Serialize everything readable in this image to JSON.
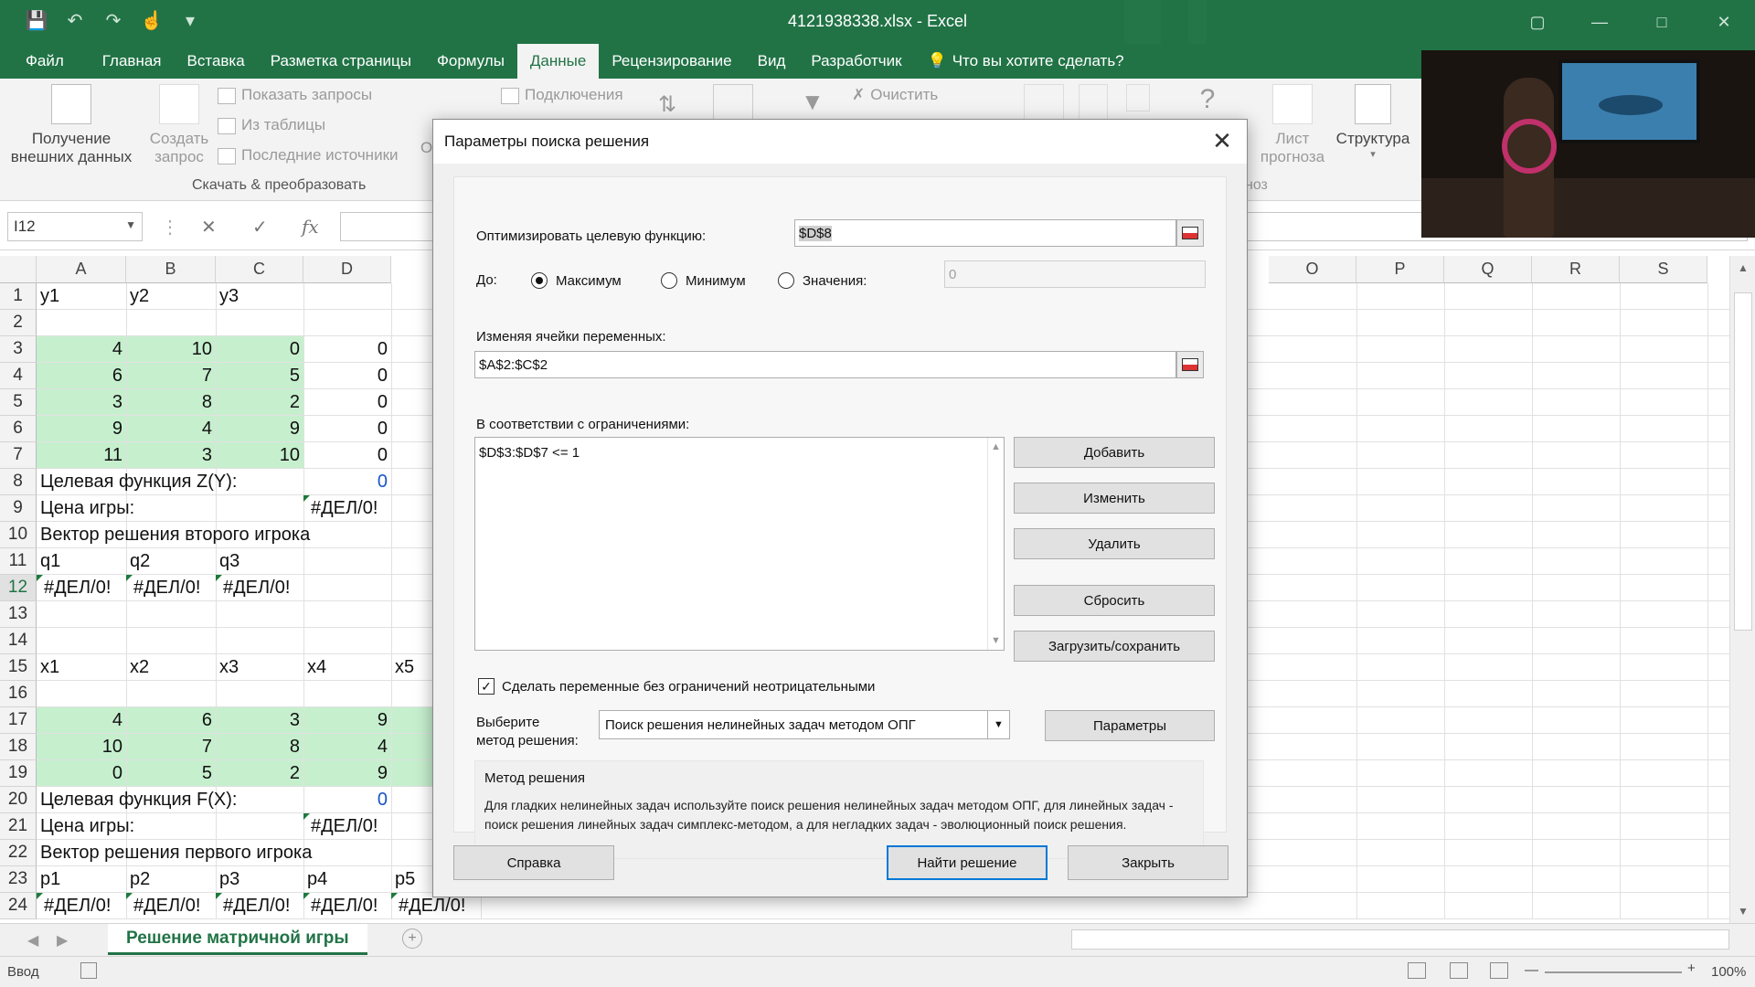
{
  "window": {
    "title": "4121938338.xlsx - Excel"
  },
  "tabs": [
    {
      "label": "Файл"
    },
    {
      "label": "Главная"
    },
    {
      "label": "Вставка"
    },
    {
      "label": "Разметка страницы"
    },
    {
      "label": "Формулы"
    },
    {
      "label": "Данные"
    },
    {
      "label": "Рецензирование"
    },
    {
      "label": "Вид"
    },
    {
      "label": "Разработчик"
    },
    {
      "label": "Что вы хотите сделать?"
    }
  ],
  "ribbon": {
    "get_external_line1": "Получение",
    "get_external_line2": "внешних данных",
    "create_query_line1": "Создать",
    "create_query_line2": "запрос",
    "show_queries": "Показать запросы",
    "from_table": "Из таблицы",
    "recent_sources": "Последние источники",
    "group_get_transform": "Скачать & преобразовать",
    "connections": "Подключения",
    "clear": "Очистить",
    "forecast_line1": "Лист",
    "forecast_line2": "прогноза",
    "forecast_group_tail": "ноз",
    "structure": "Структура",
    "partial_o": "О"
  },
  "formula_bar": {
    "name_box": "I12",
    "fx": "fx",
    "value": ""
  },
  "columns": [
    "A",
    "B",
    "C",
    "D",
    "O",
    "P",
    "Q",
    "R",
    "S"
  ],
  "rows": [
    "1",
    "2",
    "3",
    "4",
    "5",
    "6",
    "7",
    "8",
    "9",
    "10",
    "11",
    "12",
    "13",
    "14",
    "15",
    "16",
    "17",
    "18",
    "19",
    "20",
    "21",
    "22",
    "23",
    "24"
  ],
  "cells": {
    "A1": "y1",
    "B1": "y2",
    "C1": "y3",
    "A3": "4",
    "B3": "10",
    "C3": "0",
    "D3": "0",
    "A4": "6",
    "B4": "7",
    "C4": "5",
    "D4": "0",
    "A5": "3",
    "B5": "8",
    "C5": "2",
    "D5": "0",
    "A6": "9",
    "B6": "4",
    "C6": "9",
    "D6": "0",
    "A7": "11",
    "B7": "3",
    "C7": "10",
    "D7": "0",
    "A8": "Целевая функция Z(Y):",
    "D8": "0",
    "A9": "Цена игры:",
    "D9": "#ДЕЛ/0!",
    "A10": "Вектор решения второго игрока",
    "A11": "q1",
    "B11": "q2",
    "C11": "q3",
    "A12": "#ДЕЛ/0!",
    "B12": "#ДЕЛ/0!",
    "C12": "#ДЕЛ/0!",
    "A15": "x1",
    "B15": "x2",
    "C15": "x3",
    "D15": "x4",
    "E15": "x5",
    "A17": "4",
    "B17": "6",
    "C17": "3",
    "D17": "9",
    "A18": "10",
    "B18": "7",
    "C18": "8",
    "D18": "4",
    "A19": "0",
    "B19": "5",
    "C19": "2",
    "D19": "9",
    "A20": "Целевая функция F(X):",
    "D20": "0",
    "A21": "Цена игры:",
    "D21": "#ДЕЛ/0!",
    "A22": "Вектор решения первого игрока",
    "A23": "p1",
    "B23": "p2",
    "C23": "p3",
    "D23": "p4",
    "E23": "p5",
    "A24": "#ДЕЛ/0!",
    "B24": "#ДЕЛ/0!",
    "C24": "#ДЕЛ/0!",
    "D24": "#ДЕЛ/0!",
    "E24": "#ДЕЛ/0!"
  },
  "sheet": {
    "tab_label": "Решение матричной игры",
    "status": "Ввод",
    "zoom": "100%"
  },
  "dialog": {
    "title": "Параметры поиска решения",
    "objective_label": "Оптимизировать целевую функцию:",
    "objective_value": "$D$8",
    "to_label": "До:",
    "radio_max": "Максимум",
    "radio_min": "Минимум",
    "radio_value": "Значения:",
    "value_field": "0",
    "selected": "max",
    "variables_label": "Изменяя ячейки переменных:",
    "variables_value": "$A$2:$C$2",
    "constraints_label": "В соответствии с ограничениями:",
    "constraints": [
      "$D$3:$D$7 <= 1"
    ],
    "btn_add": "Добавить",
    "btn_change": "Изменить",
    "btn_delete": "Удалить",
    "btn_reset": "Сбросить",
    "btn_load_save": "Загрузить/сохранить",
    "nonneg_label": "Сделать переменные без ограничений неотрицательными",
    "nonneg_checked": true,
    "method_label_1": "Выберите",
    "method_label_2": "метод решения:",
    "method_value": "Поиск решения нелинейных задач методом ОПГ",
    "btn_params": "Параметры",
    "method_box_title": "Метод решения",
    "method_box_text": "Для гладких нелинейных задач используйте поиск решения нелинейных задач методом ОПГ, для линейных задач - поиск решения линейных задач симплекс-методом, а для негладких задач - эволюционный поиск решения.",
    "btn_help": "Справка",
    "btn_solve": "Найти решение",
    "btn_close": "Закрыть"
  },
  "colors": {
    "excel_green": "#217346",
    "cell_green": "#c6efce",
    "link_blue": "#1a55c6"
  }
}
